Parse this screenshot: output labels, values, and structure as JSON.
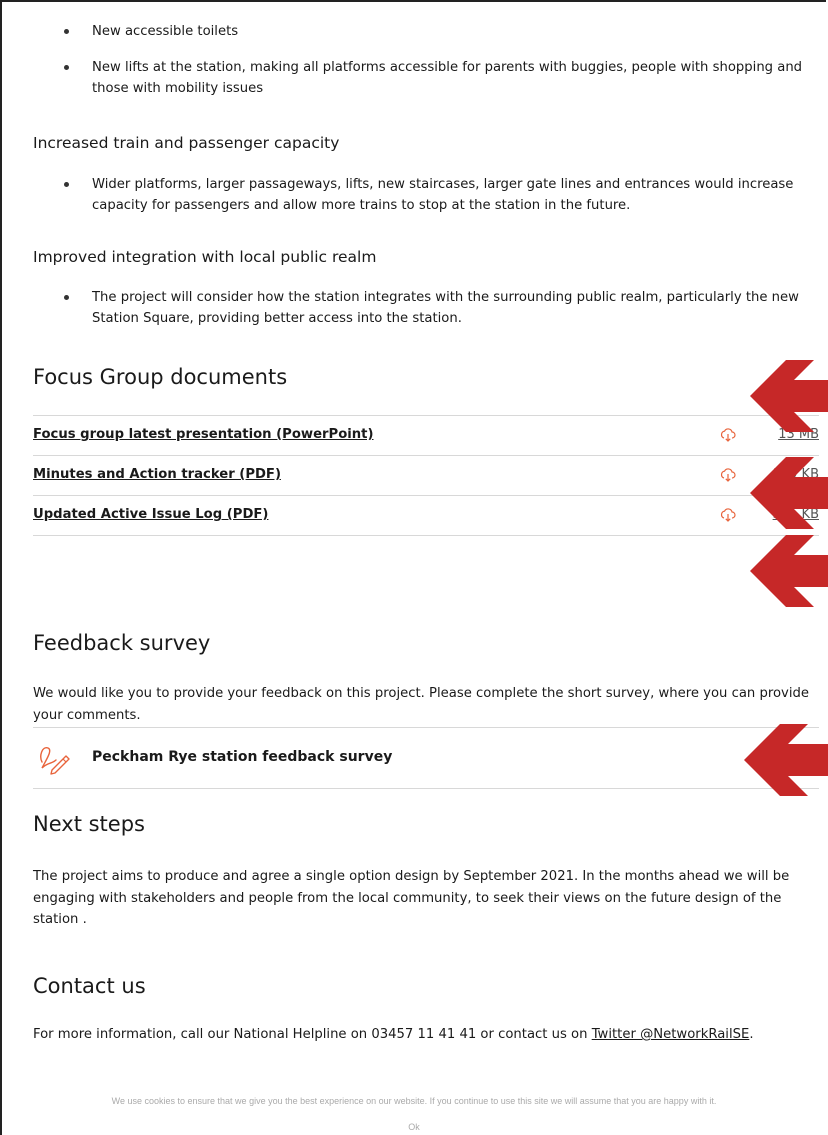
{
  "lists": {
    "accessibility": [
      "New accessible toilets",
      "New lifts at the station, making all platforms accessible for parents with buggies, people with shopping and those with mobility issues"
    ],
    "capacity": [
      "Wider platforms, larger passageways, lifts, new staircases, larger gate lines and entrances would increase capacity for passengers and allow more trains to stop at the station in the future."
    ],
    "integration": [
      "The project will consider how the station integrates with the surrounding public realm, particularly the new Station Square, providing better access into the station."
    ]
  },
  "headings": {
    "capacity": "Increased train and passenger capacity",
    "integration": "Improved integration with local public realm",
    "focus_docs": "Focus Group documents",
    "feedback": "Feedback survey",
    "next_steps": "Next steps",
    "contact": "Contact us"
  },
  "documents": [
    {
      "title": "Focus group latest presentation (PowerPoint)",
      "size": "13 MB"
    },
    {
      "title": "Minutes and Action tracker (PDF)",
      "size": "119 KB"
    },
    {
      "title": "Updated Active Issue Log (PDF)",
      "size": "371 KB"
    }
  ],
  "feedback": {
    "intro": "We would like you to provide your feedback on this project. Please complete the short survey, where you can provide your comments.",
    "survey_label": "Peckham Rye station feedback survey"
  },
  "next_steps": {
    "body": "The project aims to produce and agree a single option design by September 2021.  In the months ahead we will be engaging with stakeholders and people from the local community, to seek their views on the future design of the station ."
  },
  "contact": {
    "body_prefix": "For more information, call our National Helpline on 03457 11 41 41 or contact us on ",
    "twitter_link": "Twitter @NetworkRailSE",
    "body_suffix": "."
  },
  "cookie": {
    "message": "We use cookies to ensure that we give you the best experience on our website. If you continue to use this site we will assume that you are happy with it.",
    "ok_label": "Ok"
  },
  "colors": {
    "accent": "#d32f2f",
    "icon_orange": "#e8643c"
  }
}
